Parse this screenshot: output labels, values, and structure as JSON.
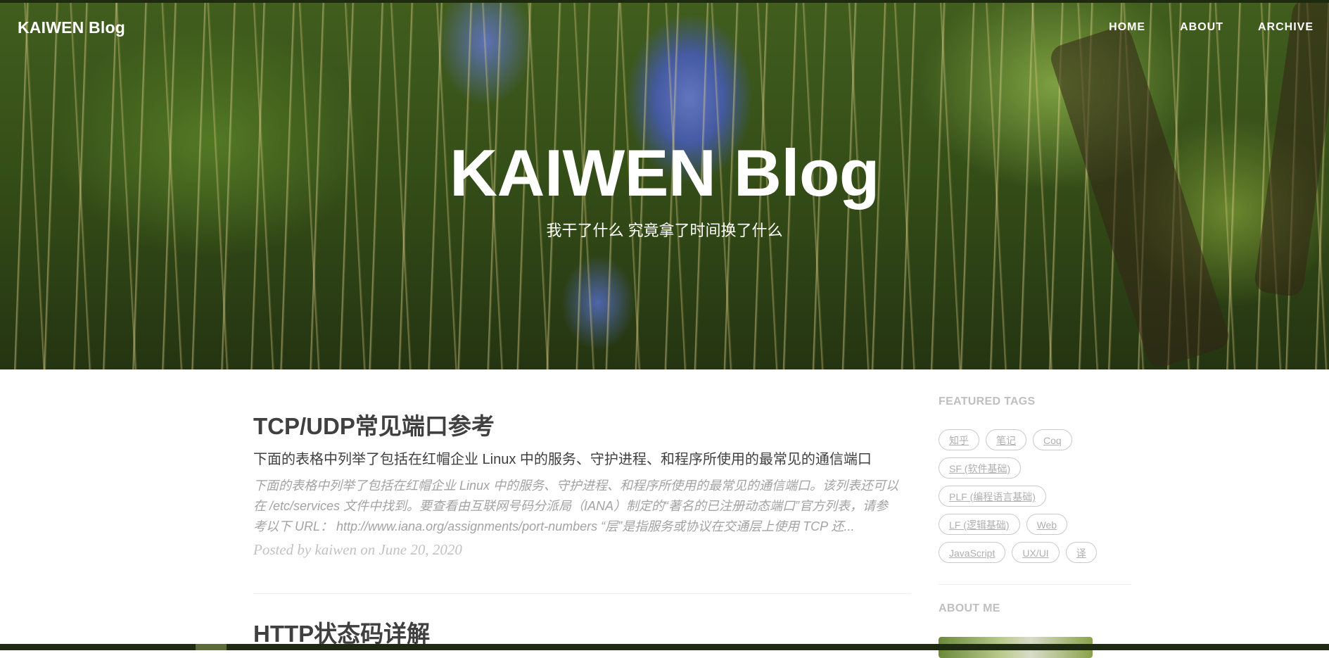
{
  "nav": {
    "brand": "KAIWEN Blog",
    "links": [
      "HOME",
      "ABOUT",
      "ARCHIVE"
    ]
  },
  "header": {
    "title": "KAIWEN Blog",
    "subtitle": "我干了什么 究竟拿了时间换了什么"
  },
  "posts": [
    {
      "title": "TCP/UDP常见端口参考",
      "subtitle": "下面的表格中列举了包括在红帽企业 Linux 中的服务、守护进程、和程序所使用的最常见的通信端口",
      "excerpt": "下面的表格中列举了包括在红帽企业 Linux 中的服务、守护进程、和程序所使用的最常见的通信端口。该列表还可以在 /etc/services 文件中找到。要查看由互联网号码分派局（IANA）制定的“著名的已注册动态端口”官方列表，请参考以下 URL： http://www.iana.org/assignments/port-numbers “层”是指服务或协议在交通层上使用 TCP 还...",
      "meta": "Posted by kaiwen on June 20, 2020"
    },
    {
      "title": "HTTP状态码详解"
    }
  ],
  "sidebar": {
    "featured_tags_heading": "FEATURED TAGS",
    "tags": [
      "知乎",
      "笔记",
      "Coq",
      "SF (软件基础)",
      "PLF (编程语言基础)",
      "LF (逻辑基础)",
      "Web",
      "JavaScript",
      "UX/UI",
      "译"
    ],
    "about_heading": "ABOUT ME"
  },
  "colors": {
    "text": "#404040",
    "muted": "#a3a3a3",
    "tag_border": "#c9c9c9",
    "sidebar_heading": "#bfbfbf"
  }
}
